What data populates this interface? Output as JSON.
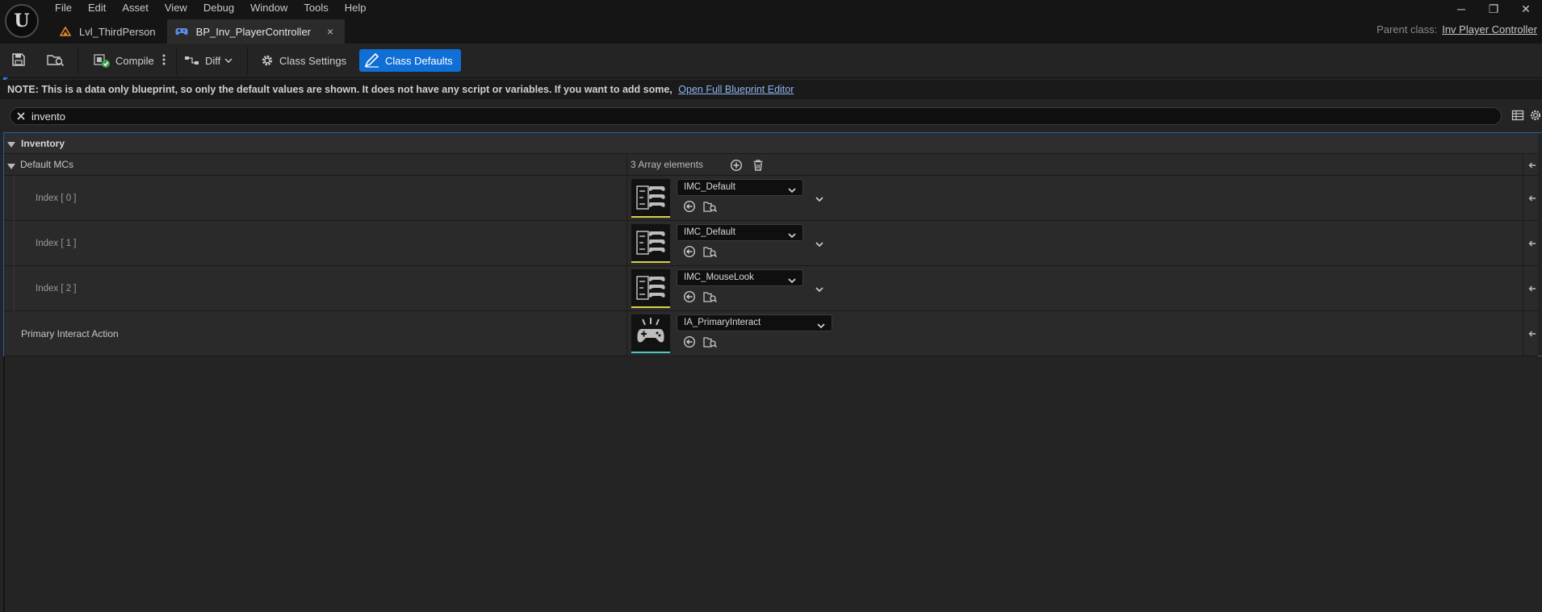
{
  "menu": [
    "File",
    "Edit",
    "Asset",
    "View",
    "Debug",
    "Window",
    "Tools",
    "Help"
  ],
  "window_controls": {
    "minimize": "─",
    "restore": "❐",
    "close": "✕"
  },
  "tabs": [
    {
      "label": "Lvl_ThirdPerson",
      "icon": "level-icon"
    },
    {
      "label": "BP_Inv_PlayerController",
      "icon": "gamepad-icon",
      "close": "×"
    }
  ],
  "parent_class": {
    "label": "Parent class:",
    "value": "Inv Player Controller"
  },
  "toolbar": {
    "compile": "Compile",
    "diff": "Diff",
    "class_settings": "Class Settings",
    "class_defaults": "Class Defaults"
  },
  "notice": {
    "text": "NOTE: This is a data only blueprint, so only the default values are shown.  It does not have any script or variables.  If you want to add some,",
    "link": "Open Full Blueprint Editor"
  },
  "search": {
    "value": "invento"
  },
  "details": {
    "category": "Inventory",
    "array": {
      "label": "Default MCs",
      "count": "3 Array elements",
      "elements": [
        {
          "index": "Index [ 0 ]",
          "asset": "IMC_Default"
        },
        {
          "index": "Index [ 1 ]",
          "asset": "IMC_Default"
        },
        {
          "index": "Index [ 2 ]",
          "asset": "IMC_MouseLook"
        }
      ]
    },
    "primary": {
      "label": "Primary Interact Action",
      "asset": "IA_PrimaryInteract"
    }
  },
  "colors": {
    "accent": "#0f6fd6",
    "context_thumb": "#d9cf4a",
    "action_thumb": "#4fc7c3",
    "selection_border": "#1f5fa8"
  }
}
